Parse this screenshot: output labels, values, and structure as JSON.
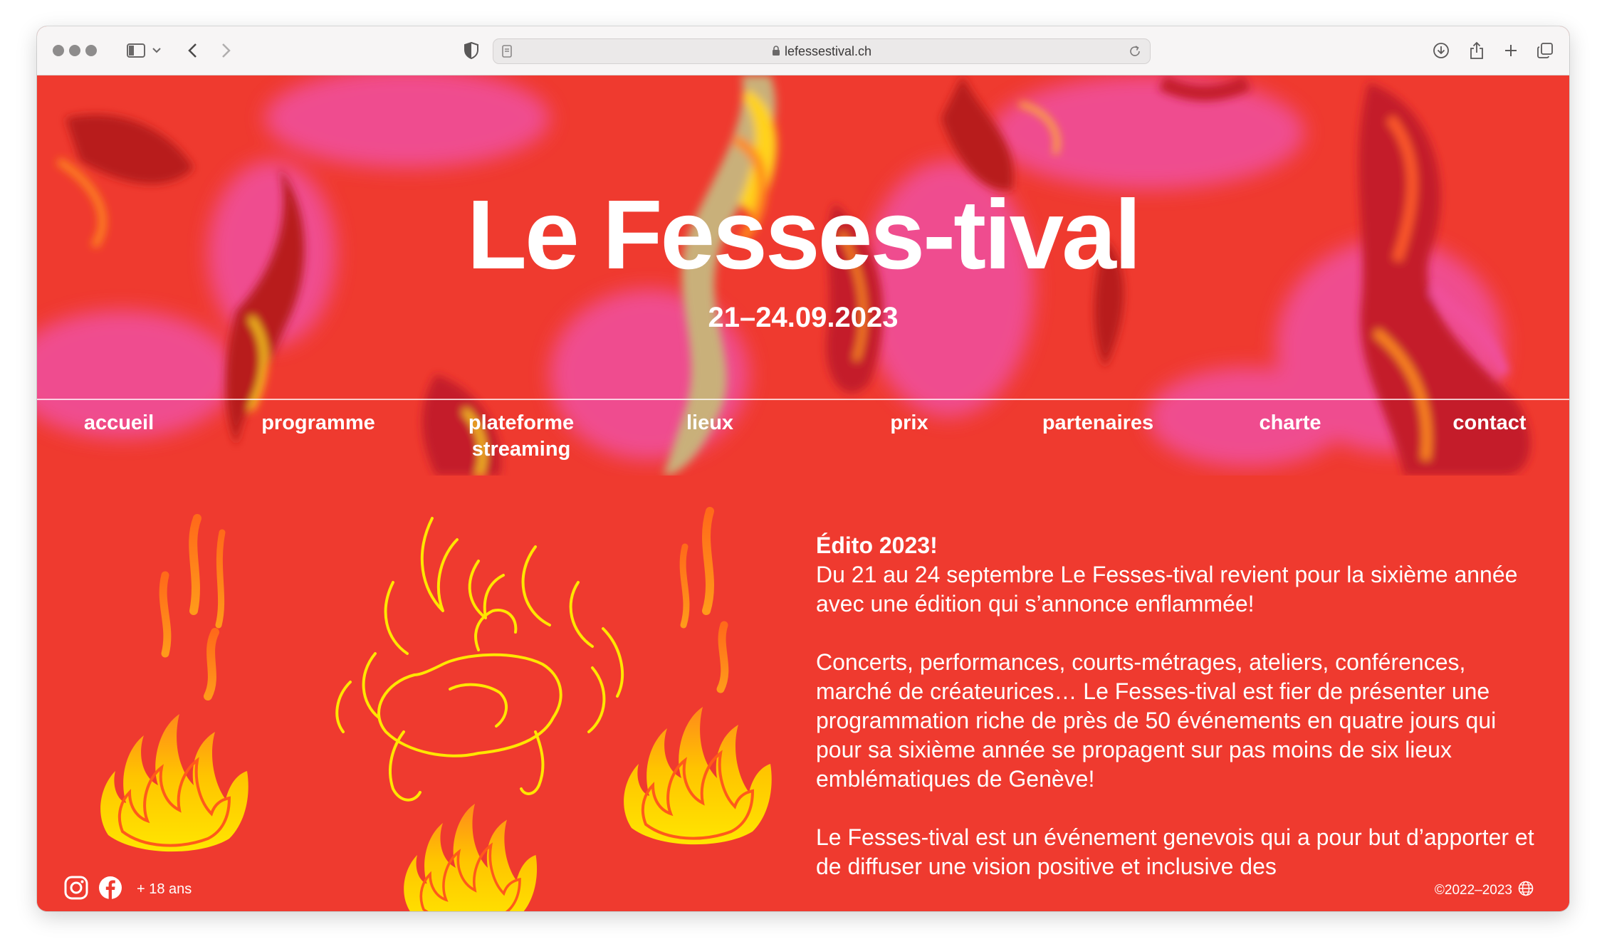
{
  "browser": {
    "url": "lefessestival.ch"
  },
  "hero": {
    "title": "Le Fesses-tival",
    "date": "21–24.09.2023"
  },
  "nav": {
    "items": [
      {
        "label": "accueil"
      },
      {
        "label": "programme"
      },
      {
        "label_line1": "plateforme",
        "label_line2": "streaming"
      },
      {
        "label": "lieux"
      },
      {
        "label": "prix"
      },
      {
        "label": "partenaires"
      },
      {
        "label": "charte"
      },
      {
        "label": "contact"
      }
    ]
  },
  "edito": {
    "heading": "Édito 2023!",
    "p1": "Du 21 au 24 septembre Le Fesses-tival revient pour la sixième année avec une édition qui s’annonce enflammée!",
    "p2": "Concerts, performances, courts-métrages, ateliers, conférences, marché de créateurices… Le Fesses-tival est fier de présenter une programmation riche de près de 50 événements en quatre jours qui pour sa sixième année se propagent sur pas moins de six lieux emblématiques de Genève!",
    "p3": "Le Fesses-tival est un événement genevois qui a pour but d’apporter et de diffuser une vision positive et inclusive des"
  },
  "footer": {
    "age_notice": "+ 18 ans",
    "copyright": "©2022–2023"
  },
  "colors": {
    "brand_red": "#ef3a2f",
    "flame_yellow": "#ffe600",
    "flame_orange": "#ff8a1a",
    "hero_pink": "#f0509a"
  },
  "icons": [
    "sidebar-icon",
    "back-icon",
    "forward-icon",
    "shield-icon",
    "lock-icon",
    "reload-icon",
    "download-icon",
    "share-icon",
    "new-tab-icon",
    "tabs-icon",
    "instagram-icon",
    "facebook-icon",
    "globe-icon"
  ]
}
